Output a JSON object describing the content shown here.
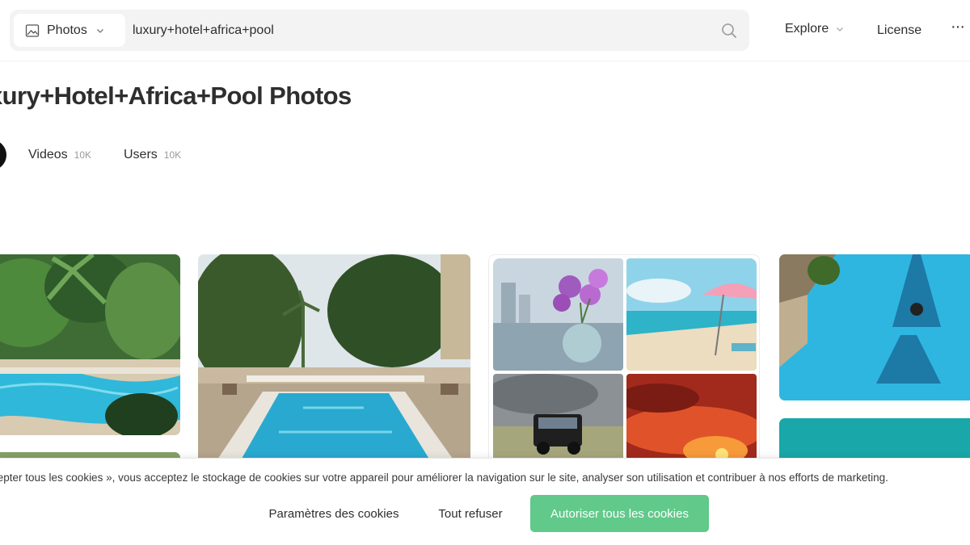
{
  "header": {
    "search_type": "Photos",
    "search_value": "luxury+hotel+africa+pool",
    "nav_explore": "Explore",
    "nav_license": "License",
    "nav_more": "···"
  },
  "page": {
    "title": "xury+Hotel+Africa+Pool Photos"
  },
  "tabs": [
    {
      "label": "Videos",
      "count": "10K"
    },
    {
      "label": "Users",
      "count": "10K"
    }
  ],
  "cookie_banner": {
    "text": "cepter tous les cookies », vous acceptez le stockage de cookies sur votre appareil pour améliorer la navigation sur le site, analyser son utilisation et contribuer à nos efforts de marketing.",
    "settings_label": "Paramètres des cookies",
    "refuse_label": "Tout refuser",
    "accept_label": "Autoriser tous les cookies"
  },
  "colors": {
    "accent_green": "#61c98a",
    "pool_blue": "#2fb8d9",
    "text_dark": "#2e2e2e"
  },
  "icons": {
    "search_type_icon": "image-icon",
    "search": "search-icon",
    "dropdown": "chevron-down-icon",
    "more": "more-horizontal-icon"
  }
}
